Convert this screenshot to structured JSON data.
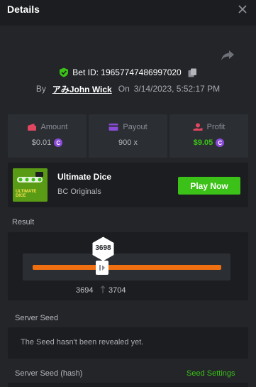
{
  "header": {
    "title": "Details"
  },
  "bet": {
    "id_label": "Bet ID: 19657747486997020",
    "by_label": "By",
    "username": "アみJohn Wick",
    "on_label": "On",
    "datetime": "3/14/2023, 5:52:17 PM"
  },
  "stats": {
    "amount": {
      "label": "Amount",
      "value": "$0.01"
    },
    "payout": {
      "label": "Payout",
      "value": "900 x"
    },
    "profit": {
      "label": "Profit",
      "value": "$9.05"
    },
    "coin_symbol": "C"
  },
  "game": {
    "thumb_text": "ULTIMATE DICE",
    "name": "Ultimate Dice",
    "provider": "BC Originals",
    "play_label": "Play Now"
  },
  "result": {
    "label": "Result",
    "value": "3698",
    "range_low": "3694",
    "range_high": "3704"
  },
  "server_seed": {
    "label": "Server Seed",
    "placeholder": "The Seed hasn't been revealed yet."
  },
  "server_seed_hash": {
    "label": "Server Seed (hash)",
    "settings_link": "Seed Settings"
  },
  "colors": {
    "accent_green": "#3bc117",
    "slider_orange": "#ef6f11",
    "coin_purple": "#8a4bd8",
    "amount_icon": "#e0465f",
    "payout_icon": "#8a4bd8",
    "profit_icon": "#e0465f"
  },
  "icons": {
    "close": "close-icon",
    "share": "share-icon",
    "verified": "shield-check-icon",
    "copy": "copy-icon",
    "amount": "wallet-icon",
    "payout": "card-icon",
    "profit": "hand-coin-icon",
    "handle": "pause-icon"
  }
}
